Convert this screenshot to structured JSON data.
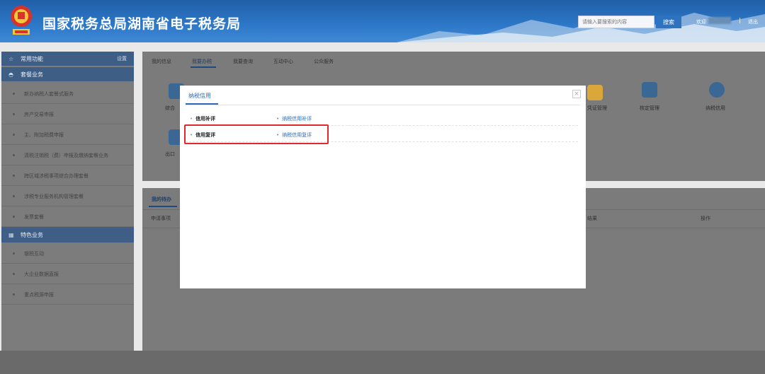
{
  "header": {
    "title": "国家税务总局湖南省电子税务局",
    "search_placeholder": "请输入要搜索的内容",
    "search_button": "搜索",
    "welcome": "欢迎",
    "separator": "|",
    "logout": "退出",
    "colors": {
      "bar": "#2d78c8",
      "accent": "#e0282d"
    }
  },
  "sidebar": {
    "common_label": "常用功能",
    "setting_label": "设置",
    "package_label": "套餐业务",
    "package_items": [
      "新办纳税人套餐式服务",
      "房产交易申报",
      "主、附加税费申报",
      "清税注销税（费）申报及缴纳套餐业务",
      "跨区域涉税事项综合办理套餐",
      "涉税专业服务机构管理套餐",
      "发票套餐"
    ],
    "special_label": "特色业务",
    "special_items": [
      "银税互动",
      "大企业数据直报",
      "重点税源申报"
    ]
  },
  "tabs": [
    "我的信息",
    "我要办税",
    "我要查询",
    "互动中心",
    "公众服务"
  ],
  "tiles": [
    {
      "label": "综合",
      "icon": "document-icon"
    },
    {
      "label": "出口",
      "icon": "export-icon"
    },
    {
      "label": "凭证管理",
      "icon": "certificate-icon"
    },
    {
      "label": "核定管理",
      "icon": "monitor-icon"
    },
    {
      "label": "纳税信用",
      "icon": "shield-check-icon"
    }
  ],
  "todo": {
    "tab": "我的待办",
    "col_item": "申请事项",
    "col_result": "结果",
    "col_action": "操作"
  },
  "modal": {
    "title": "纳税信用",
    "rows": [
      {
        "category": "信用补评",
        "link": "纳税信用补评"
      },
      {
        "category": "信用复评",
        "link": "纳税信用复评"
      }
    ]
  }
}
